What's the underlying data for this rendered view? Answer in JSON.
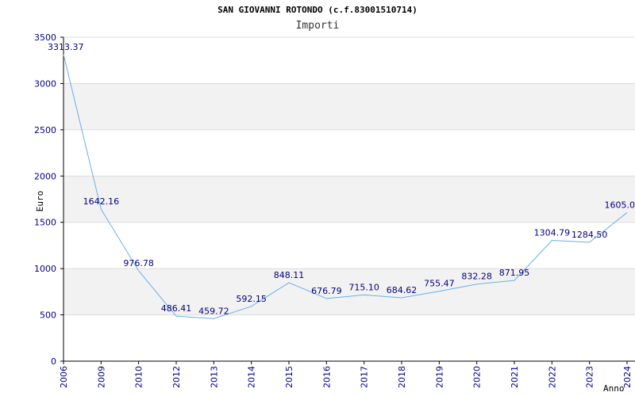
{
  "chart_data": {
    "type": "line",
    "title": "SAN GIOVANNI ROTONDO (c.f.83001510714)",
    "subtitle": "Importi",
    "xlabel": "Anno",
    "ylabel": "Euro",
    "ylim": [
      0,
      3500
    ],
    "yticks": [
      0,
      500,
      1000,
      1500,
      2000,
      2500,
      3000,
      3500
    ],
    "categories": [
      "2006",
      "2009",
      "2010",
      "2012",
      "2013",
      "2014",
      "2015",
      "2016",
      "2017",
      "2018",
      "2019",
      "2020",
      "2021",
      "2022",
      "2023",
      "2024"
    ],
    "values": [
      3313.37,
      1642.16,
      976.78,
      486.41,
      459.72,
      592.15,
      848.11,
      676.79,
      715.1,
      684.62,
      755.47,
      832.28,
      871.95,
      1304.79,
      1284.5,
      1605.0
    ],
    "labels": [
      "3313.37",
      "1642.16",
      "976.78",
      "486.41",
      "459.72",
      "592.15",
      "848.11",
      "676.79",
      "715.10",
      "684.62",
      "755.47",
      "832.28",
      "871.95",
      "1304.79",
      "1284.50",
      "1605.0"
    ],
    "grid": true,
    "colors": {
      "line": "#6aaeea",
      "band": "#f2f2f2",
      "grid": "#dcdcdc",
      "ticks": "#00008b",
      "labels": "#000080"
    }
  }
}
